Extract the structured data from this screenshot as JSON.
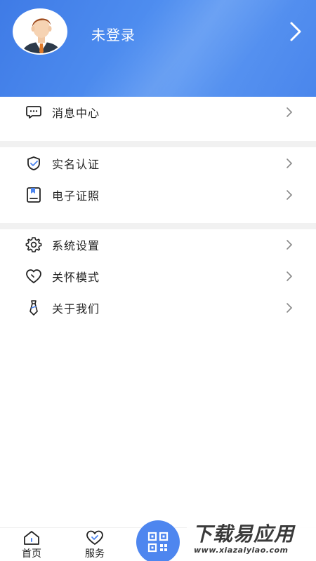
{
  "header": {
    "login_status": "未登录",
    "background_color": "#4a86ec"
  },
  "menu": {
    "group1": [
      {
        "label": "消息中心",
        "icon": "message-icon"
      }
    ],
    "group2": [
      {
        "label": "实名认证",
        "icon": "shield-check-icon"
      },
      {
        "label": "电子证照",
        "icon": "certificate-icon"
      }
    ],
    "group3": [
      {
        "label": "系统设置",
        "icon": "gear-icon"
      },
      {
        "label": "关怀模式",
        "icon": "heart-icon"
      },
      {
        "label": "关于我们",
        "icon": "tie-icon"
      }
    ]
  },
  "tabbar": {
    "tabs": [
      {
        "label": "首页",
        "icon": "home-icon"
      },
      {
        "label": "服务",
        "icon": "service-heart-icon"
      }
    ],
    "scan_icon": "qr-code-icon",
    "accent": "#4e86ef"
  },
  "watermark": {
    "title": "下载易应用",
    "url": "www.xiazaiyiao.com"
  }
}
